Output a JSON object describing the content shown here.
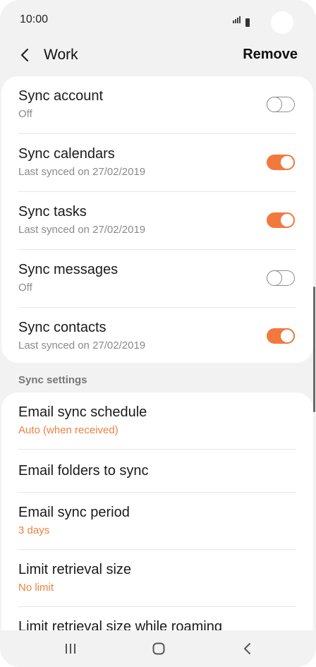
{
  "status_bar": {
    "time": "10:00"
  },
  "header": {
    "title": "Work",
    "remove_label": "Remove"
  },
  "sync_items": [
    {
      "label": "Sync account",
      "status": "Off",
      "toggle": "off"
    },
    {
      "label": "Sync calendars",
      "status": "Last synced on 27/02/2019",
      "toggle": "on"
    },
    {
      "label": "Sync tasks",
      "status": "Last synced on 27/02/2019",
      "toggle": "on"
    },
    {
      "label": "Sync messages",
      "status": "Off",
      "toggle": "off"
    },
    {
      "label": "Sync contacts",
      "status": "Last synced on 27/02/2019",
      "toggle": "on"
    }
  ],
  "sync_settings": {
    "section_label": "Sync settings",
    "items": [
      {
        "label": "Email sync schedule",
        "value": "Auto (when received)"
      },
      {
        "label": "Email folders to sync"
      },
      {
        "label": "Email sync period",
        "value": "3 days"
      },
      {
        "label": "Limit retrieval size",
        "value": "No limit"
      },
      {
        "label": "Limit retrieval size while roaming"
      }
    ]
  },
  "colors": {
    "accent": "#f2793d",
    "background": "#f2f2f2",
    "card": "#ffffff"
  }
}
